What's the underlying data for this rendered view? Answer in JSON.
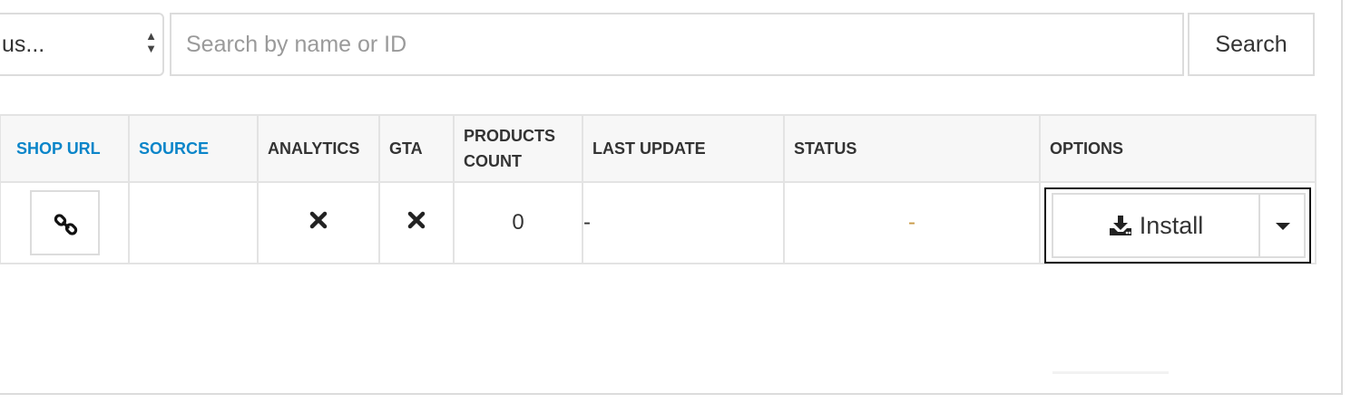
{
  "filters": {
    "status_select": {
      "value": "us...",
      "arrow_up": "▲",
      "arrow_down": "▼"
    },
    "search": {
      "placeholder": "Search by name or ID",
      "value": ""
    },
    "search_button_label": "Search"
  },
  "table": {
    "columns": [
      {
        "label": "SHOP URL",
        "sortable": true
      },
      {
        "label": "SOURCE",
        "sortable": true
      },
      {
        "label": "ANALYTICS",
        "sortable": false
      },
      {
        "label": "GTA",
        "sortable": false
      },
      {
        "label": "PRODUCTS COUNT",
        "sortable": false
      },
      {
        "label": "LAST UPDATE",
        "sortable": false
      },
      {
        "label": "STATUS",
        "sortable": false
      },
      {
        "label": "OPTIONS",
        "sortable": false
      }
    ],
    "rows": [
      {
        "shop_url_icon": "link-icon",
        "source": "",
        "analytics_icon": "x-icon",
        "gta_icon": "x-icon",
        "products_count": "0",
        "last_update": "-",
        "status": "-",
        "options": {
          "install_label": "Install",
          "install_icon": "download-icon",
          "dropdown_icon": "caret-down-icon"
        }
      }
    ]
  },
  "colors": {
    "sortable_header": "#0a85c9",
    "status_dash": "#c89a45",
    "header_bg": "#f7f7f7",
    "border": "#e3e3e3",
    "focus_outline": "#111111"
  }
}
